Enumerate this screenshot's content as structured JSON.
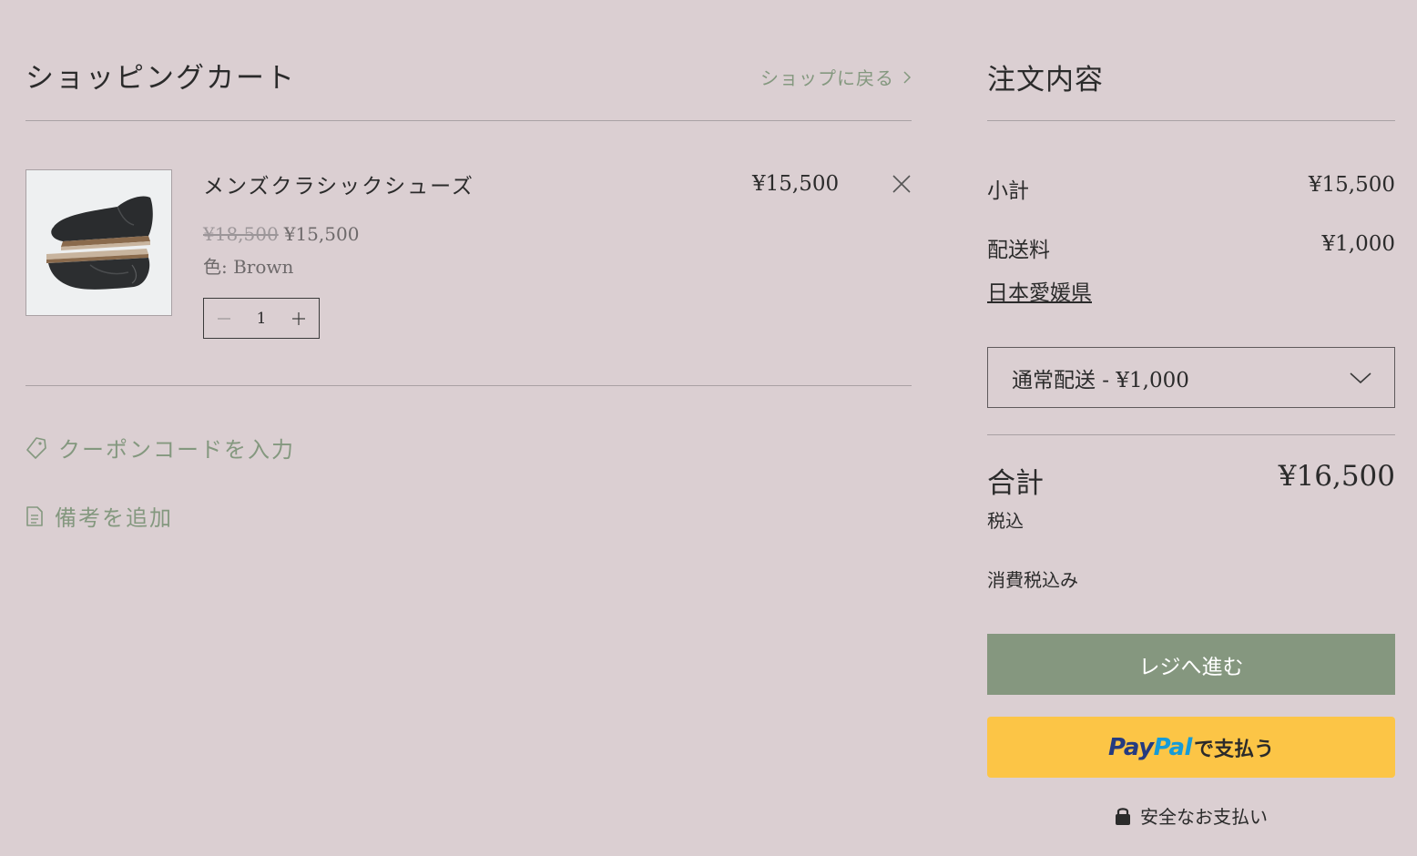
{
  "cart": {
    "title": "ショッピングカート",
    "back_link": "ショップに戻る",
    "item": {
      "name": "メンズクラシックシューズ",
      "original_price": "¥18,500",
      "sale_price": "¥15,500",
      "variant": "色: Brown",
      "quantity": "1",
      "line_total": "¥15,500",
      "image_icon": "shoe-image"
    },
    "coupon_link": "クーポンコードを入力",
    "note_link": "備考を追加"
  },
  "summary": {
    "title": "注文内容",
    "subtotal_label": "小計",
    "subtotal_value": "¥15,500",
    "shipping_label": "配送料",
    "shipping_value": "¥1,000",
    "shipping_region": "日本愛媛県",
    "shipping_option": "通常配送 - ¥1,000",
    "total_label": "合計",
    "total_value": "¥16,500",
    "tax_included": "税込",
    "tax_note": "消費税込み",
    "checkout_button": "レジへ進む",
    "paypal_pay": "Pay",
    "paypal_pal": "Pal",
    "paypal_suffix": "で支払う",
    "secure_payment": "安全なお支払い"
  },
  "colors": {
    "background": "#dbcfd2",
    "accent": "#85977f",
    "paypal_yellow": "#fcc546",
    "link": "#84987f"
  }
}
